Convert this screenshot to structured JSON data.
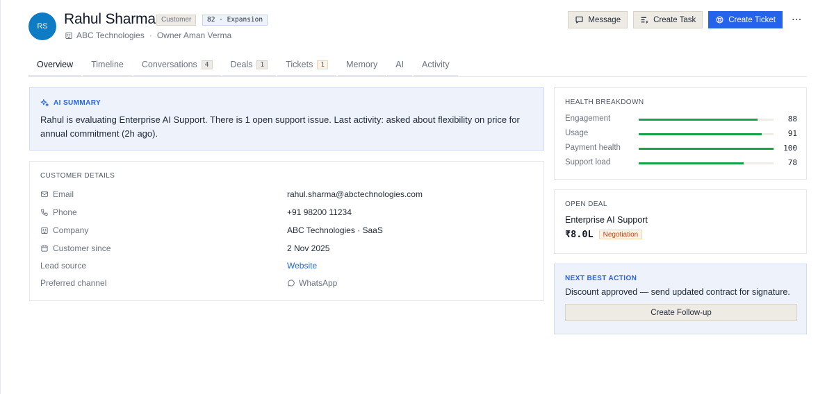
{
  "profile": {
    "initials": "RS",
    "name": "Rahul Sharma",
    "type_badge": "Customer",
    "score_badge": "82 · Expansion",
    "company": "ABC Technologies",
    "separator": "·",
    "owner": "Owner Aman Verma"
  },
  "actions": {
    "message": "Message",
    "create_task": "Create Task",
    "create_ticket": "Create Ticket",
    "more": "···"
  },
  "tabs": [
    {
      "label": "Overview",
      "count": null,
      "active": true
    },
    {
      "label": "Timeline",
      "count": null
    },
    {
      "label": "Conversations",
      "count": "4"
    },
    {
      "label": "Deals",
      "count": "1"
    },
    {
      "label": "Tickets",
      "count": "1"
    },
    {
      "label": "Memory",
      "count": null
    },
    {
      "label": "AI",
      "count": null
    },
    {
      "label": "Activity",
      "count": null
    }
  ],
  "ai_summary": {
    "title": "AI SUMMARY",
    "text": "Rahul is evaluating Enterprise AI Support. There is 1 open support issue. Last activity: asked about flexibility on price for annual commitment (2h ago)."
  },
  "customer_details": {
    "title": "CUSTOMER DETAILS",
    "rows": [
      {
        "label": "Email",
        "value": "rahul.sharma@abctechnologies.com",
        "icon": "mail-icon"
      },
      {
        "label": "Phone",
        "value": "+91 98200 11234",
        "icon": "phone-icon"
      },
      {
        "label": "Company",
        "value": "ABC Technologies · SaaS",
        "icon": "building-icon"
      },
      {
        "label": "Customer since",
        "value": "2 Nov 2025",
        "icon": "calendar-icon"
      },
      {
        "label": "Lead source",
        "value": "Website"
      },
      {
        "label": "Preferred channel",
        "value": "WhatsApp",
        "icon": "chat-bubble-icon"
      }
    ]
  },
  "health": {
    "title": "HEALTH BREAKDOWN",
    "accent": "#16a34a",
    "rows": [
      {
        "label": "Engagement",
        "value": "88",
        "fraction": 0.88
      },
      {
        "label": "Usage",
        "value": "91",
        "fraction": 0.91
      },
      {
        "label": "Payment health",
        "value": "100",
        "fraction": 1.0
      },
      {
        "label": "Support load",
        "value": "78",
        "fraction": 0.78
      }
    ]
  },
  "open_deal": {
    "title": "OPEN DEAL",
    "name": "Enterprise AI Support",
    "amount": "₹8.0L",
    "stage": "Negotiation"
  },
  "next_best_action": {
    "title": "NEXT BEST ACTION",
    "text": "Discount approved — send updated contract for signature.",
    "button": "Create Follow-up"
  },
  "colors": {
    "primary": "#2563eb",
    "avatar": "#0e7cc4",
    "stage_orange": "#c2410c"
  }
}
